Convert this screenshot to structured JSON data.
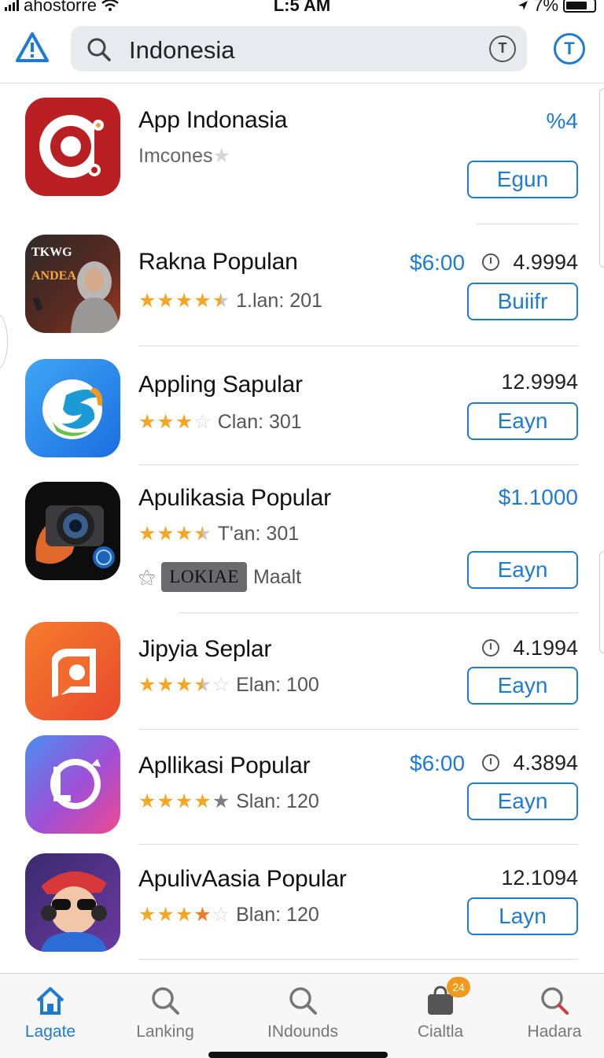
{
  "status_bar": {
    "carrier": "ahostorre",
    "time": "L:5 AM",
    "battery": "7%"
  },
  "search": {
    "query": "Indonesia",
    "clear_glyph": "T",
    "timer_glyph": "T"
  },
  "apps": [
    {
      "name": "App Indonasia",
      "subtitle": "Imcones",
      "rating_stars": 0,
      "rating_text": "",
      "price": "%4",
      "score": "",
      "button": "Egun",
      "icon": "red-ring-logo-icon"
    },
    {
      "name": "Rakna Populan",
      "rating_stars": 4.5,
      "rating_text": "1.lan: 201",
      "price": "$6:00",
      "score": "4.9994",
      "button": "Buiifr",
      "icon": "presenter-woman-icon",
      "icon_text_1": "TKWG",
      "icon_text_2": "ANDEA"
    },
    {
      "name": "Appling Sapular",
      "rating_stars": 3,
      "rating_text": "Clan: 301",
      "price": "",
      "score": "12.9994",
      "button": "Eayn",
      "icon": "blue-swirl-logo-icon"
    },
    {
      "name": "Apulikasia Popular",
      "rating_stars": 3.5,
      "rating_text": "T'an: 301",
      "price": "$1.1000",
      "score": "",
      "button": "Eayn",
      "icon": "camera-hand-icon",
      "tag_label": "LOKIAE",
      "tag_suffix": "Maalt"
    },
    {
      "name": "Jipyia Seplar",
      "rating_stars": 3.5,
      "rating_text": "Elan: 100",
      "price": "",
      "score": "4.1994",
      "button": "Eayn",
      "icon": "orange-document-icon"
    },
    {
      "name": "Apllikasi Popular",
      "rating_stars": 5,
      "rating_text": "Slan: 120",
      "price": "$6:00",
      "score": "4.3894",
      "button": "Eayn",
      "icon": "gradient-lo-logo-icon"
    },
    {
      "name": "ApulivAasia Popular",
      "rating_stars": 4,
      "rating_text": "Blan: 120",
      "price": "",
      "score": "12.1094",
      "button": "Layn",
      "icon": "sunglasses-character-icon"
    }
  ],
  "tabbar": {
    "tabs": [
      {
        "label": "Lagate",
        "icon": "home-icon",
        "active": true
      },
      {
        "label": "Lanking",
        "icon": "search-icon"
      },
      {
        "label": "INdounds",
        "icon": "search-icon"
      },
      {
        "label": "Cialtla",
        "icon": "bag-icon",
        "badge": "24"
      },
      {
        "label": "Hadara",
        "icon": "search-icon"
      }
    ]
  },
  "colors": {
    "accent": "#1e7bd4",
    "star": "#f5a623",
    "badge": "#f29a1d"
  }
}
